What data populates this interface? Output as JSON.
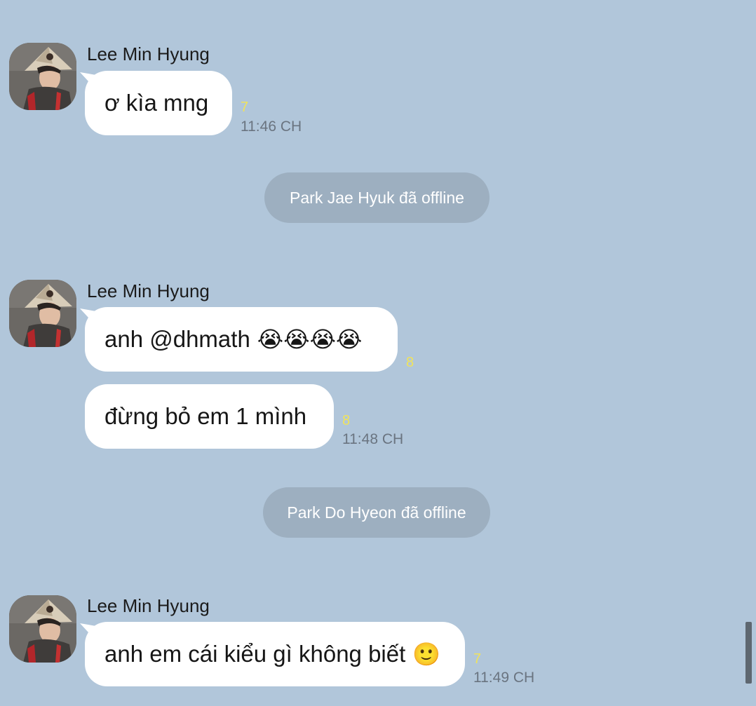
{
  "messages": [
    {
      "sender": "Lee Min Hyung",
      "bubbles": [
        {
          "text": "ơ kìa mng",
          "emoji": "",
          "read_count": "7"
        }
      ],
      "time": "11:46 CH"
    },
    {
      "sender": "Lee Min Hyung",
      "bubbles": [
        {
          "text": "anh @dhmath",
          "emoji": "😭😭😭😭",
          "read_count": "8"
        },
        {
          "text": "đừng bỏ em 1 mình",
          "emoji": "",
          "read_count": "8"
        }
      ],
      "time": "11:48 CH"
    },
    {
      "sender": "Lee Min Hyung",
      "bubbles": [
        {
          "text": "anh em cái kiểu gì không biết",
          "emoji": "🙂",
          "read_count": "7"
        }
      ],
      "time": "11:49 CH"
    }
  ],
  "system_notices": [
    "Park Jae Hyuk đã offline",
    "Park Do Hyeon đã offline"
  ],
  "icons": {
    "avatar": "user-avatar-conical-hat",
    "emoji_crying": "loudly-crying-face",
    "emoji_smile": "slightly-smiling-face"
  },
  "colors": {
    "background": "#b1c6da",
    "bubble": "#ffffff",
    "read_count": "#f1e35a",
    "system_pill": "#9dafc0",
    "timestamp": "#6a7480"
  }
}
